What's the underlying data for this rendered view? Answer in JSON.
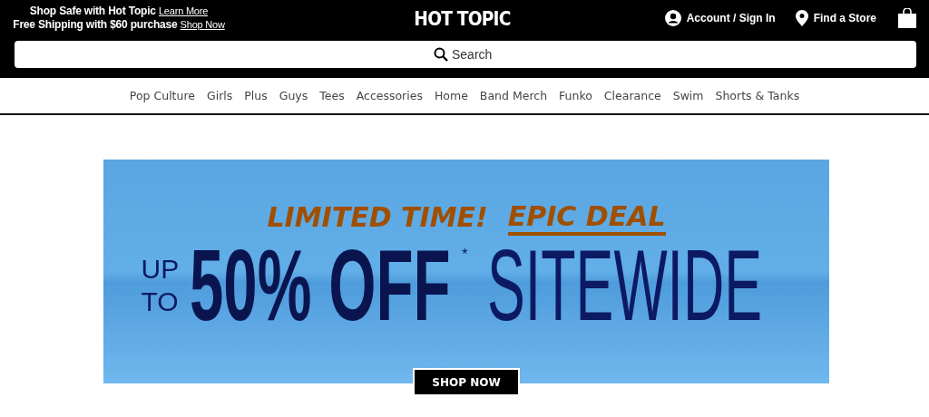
{
  "promo_lines": [
    {
      "text": "Shop Safe with Hot Topic",
      "link": "Learn More"
    },
    {
      "text": "Free Shipping with $60 purchase",
      "link": "Shop Now"
    }
  ],
  "logo": "HOT TOPIC",
  "account": "Account / Sign In",
  "store": "Find a Store",
  "search": {
    "placeholder": "Search"
  },
  "nav": [
    "Pop Culture",
    "Girls",
    "Plus",
    "Guys",
    "Tees",
    "Accessories",
    "Home",
    "Band Merch",
    "Funko",
    "Clearance",
    "Swim",
    "Shorts & Tanks"
  ],
  "banner": {
    "headline": "LIMITED TIME!",
    "highlight": "EPIC DEAL",
    "prefix": [
      "UP",
      "TO"
    ],
    "amount": "50% OFF",
    "footnote": "*",
    "scope": "SITEWIDE",
    "button": "SHOP NOW"
  }
}
